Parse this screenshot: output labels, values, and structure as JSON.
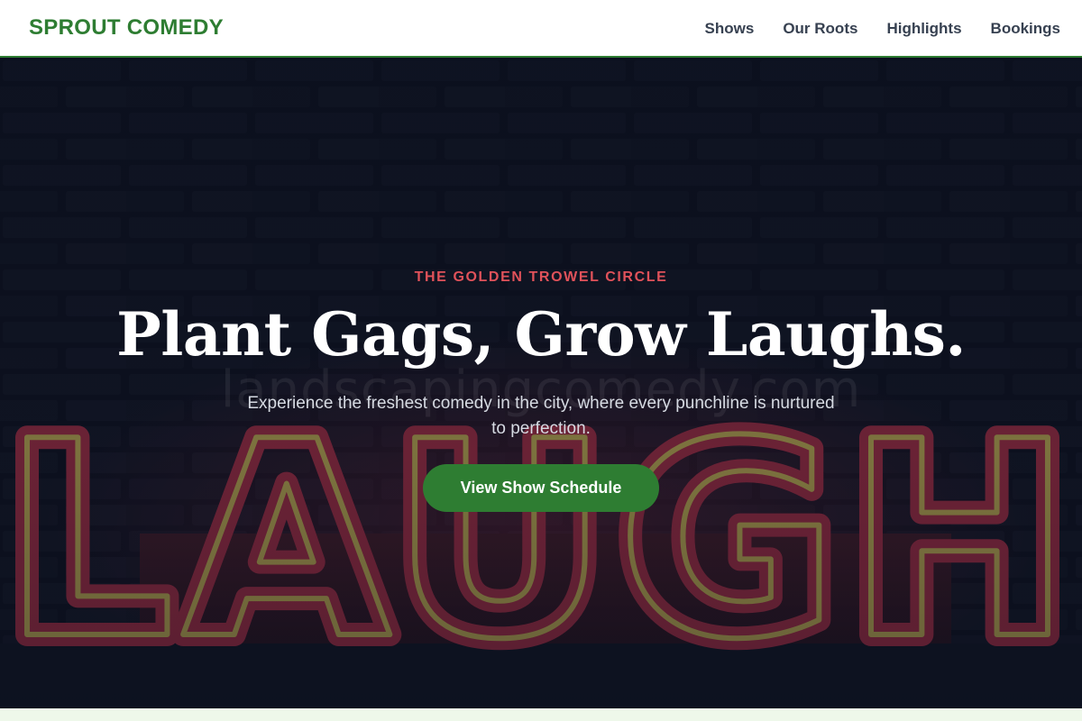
{
  "header": {
    "brand": "SPROUT COMEDY",
    "nav": [
      {
        "label": "Shows"
      },
      {
        "label": "Our Roots"
      },
      {
        "label": "Highlights"
      },
      {
        "label": "Bookings"
      }
    ]
  },
  "hero": {
    "eyebrow": "THE GOLDEN TROWEL CIRCLE",
    "headline": "Plant Gags, Grow Laughs.",
    "subtext": "Experience the freshest comedy in the city, where every punchline is nurtured to perfection.",
    "cta_label": "View Show Schedule",
    "watermark": "landscapingcomedy.com",
    "neon_sign_text": "LAUGH"
  },
  "colors": {
    "brand": "#2e7d32",
    "accent": "#e0525a",
    "hero_bg": "#111625"
  }
}
